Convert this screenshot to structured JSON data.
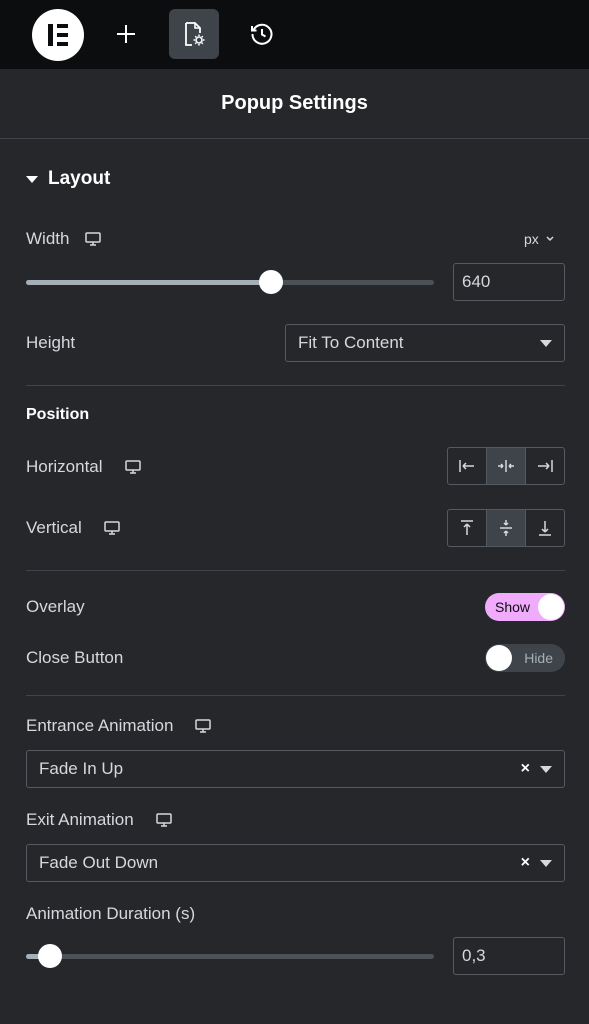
{
  "header": {
    "title": "Popup Settings"
  },
  "section": {
    "title": "Layout"
  },
  "width": {
    "label": "Width",
    "unit": "px",
    "value": "640",
    "slider_fraction": 0.6
  },
  "height": {
    "label": "Height",
    "value": "Fit To Content"
  },
  "position": {
    "title": "Position",
    "horizontal_label": "Horizontal",
    "vertical_label": "Vertical"
  },
  "overlay": {
    "label": "Overlay",
    "state": "Show"
  },
  "close_button": {
    "label": "Close Button",
    "state": "Hide"
  },
  "entrance": {
    "label": "Entrance Animation",
    "value": "Fade In Up"
  },
  "exit": {
    "label": "Exit Animation",
    "value": "Fade Out Down"
  },
  "duration": {
    "label": "Animation Duration (s)",
    "value": "0,3",
    "slider_fraction": 0.06
  },
  "colors": {
    "accent_toggle": "#f0abfc",
    "panel_bg": "#26272b",
    "topbar_bg": "#0c0d0e"
  },
  "icons": [
    "elementor-logo-icon",
    "plus-icon",
    "page-settings-icon",
    "history-icon",
    "desktop-icon",
    "align-left-icon",
    "align-center-icon",
    "align-right-icon",
    "align-top-icon",
    "align-middle-icon",
    "align-bottom-icon"
  ]
}
